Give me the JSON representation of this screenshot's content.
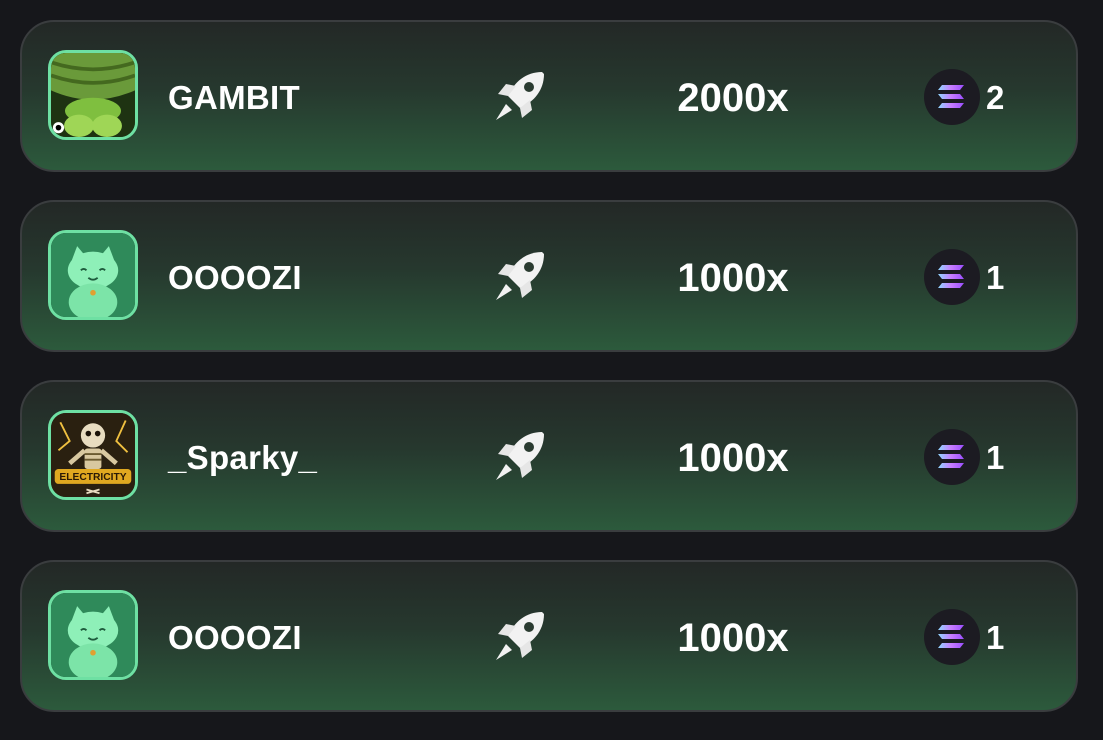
{
  "rows": [
    {
      "avatar_icon": "frog-avatar-icon",
      "name": "GAMBIT",
      "action_icon": "rocket-icon",
      "multiplier": "2000x",
      "currency_icon": "solana-coin-icon",
      "amount": "2"
    },
    {
      "avatar_icon": "lucky-cat-avatar-icon",
      "name": "OOOOZI",
      "action_icon": "rocket-icon",
      "multiplier": "1000x",
      "currency_icon": "solana-coin-icon",
      "amount": "1"
    },
    {
      "avatar_icon": "skeleton-electricity-avatar-icon",
      "avatar_text": "ELECTRICITY",
      "name": "_Sparky_",
      "action_icon": "rocket-icon",
      "multiplier": "1000x",
      "currency_icon": "solana-coin-icon",
      "amount": "1"
    },
    {
      "avatar_icon": "lucky-cat-avatar-icon",
      "name": "OOOOZI",
      "action_icon": "rocket-icon",
      "multiplier": "1000x",
      "currency_icon": "solana-coin-icon",
      "amount": "1"
    }
  ],
  "colors": {
    "avatar_border": "#6ee0a3",
    "row_gradient_top": "#232826",
    "row_gradient_bottom": "#2c5a3c",
    "background": "#16171b"
  }
}
